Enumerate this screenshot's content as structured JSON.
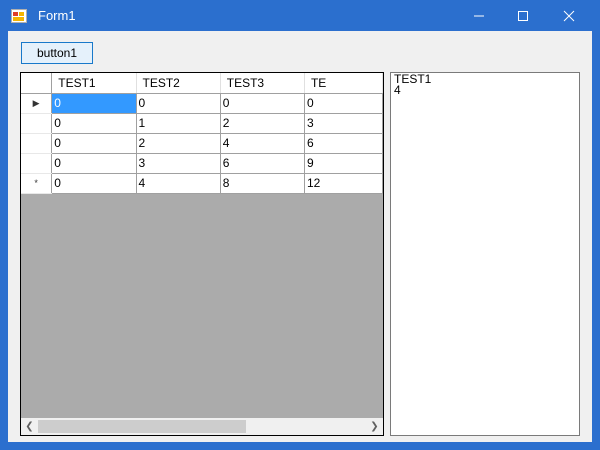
{
  "window": {
    "title": "Form1"
  },
  "toolbar": {
    "button1_label": "button1"
  },
  "grid": {
    "columns": [
      "TEST1",
      "TEST2",
      "TEST3",
      "TE"
    ],
    "rows": [
      {
        "marker": "▶",
        "cells": [
          "0",
          "0",
          "0",
          "0"
        ]
      },
      {
        "marker": "",
        "cells": [
          "0",
          "1",
          "2",
          "3"
        ]
      },
      {
        "marker": "",
        "cells": [
          "0",
          "2",
          "4",
          "6"
        ]
      },
      {
        "marker": "",
        "cells": [
          "0",
          "3",
          "6",
          "9"
        ]
      },
      {
        "marker": "*",
        "cells": [
          "0",
          "4",
          "8",
          "12"
        ]
      }
    ],
    "selected_row": 0,
    "selected_col": 0,
    "selection_color": "#3399ff"
  },
  "textbox": {
    "lines": [
      "TEST1",
      "4"
    ]
  },
  "colors": {
    "titlebar": "#2b6fce",
    "client": "#f0f0f0",
    "grid_background": "#ababab"
  }
}
